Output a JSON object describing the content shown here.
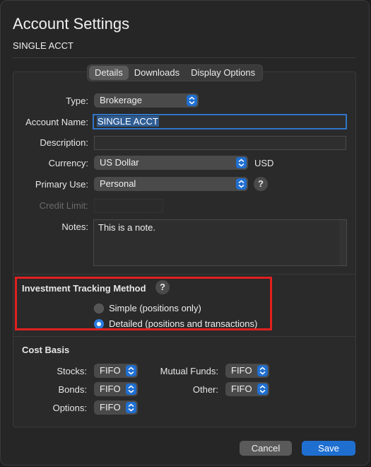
{
  "window": {
    "title": "Account Settings",
    "subtitle": "SINGLE ACCT"
  },
  "tabs": [
    {
      "label": "Details",
      "active": true
    },
    {
      "label": "Downloads",
      "active": false
    },
    {
      "label": "Display Options",
      "active": false
    }
  ],
  "details": {
    "type_label": "Type:",
    "type_value": "Brokerage",
    "account_name_label": "Account Name:",
    "account_name_value": "SINGLE ACCT",
    "description_label": "Description:",
    "description_value": "",
    "currency_label": "Currency:",
    "currency_value": "US Dollar",
    "currency_code": "USD",
    "primary_use_label": "Primary Use:",
    "primary_use_value": "Personal",
    "credit_limit_label": "Credit Limit:",
    "credit_limit_value": "",
    "notes_label": "Notes:",
    "notes_value": "This is a note."
  },
  "tracking": {
    "title": "Investment Tracking Method",
    "help": "?",
    "options": [
      {
        "label": "Simple (positions only)",
        "selected": false
      },
      {
        "label": "Detailed (positions and transactions)",
        "selected": true
      }
    ]
  },
  "cost_basis": {
    "title": "Cost Basis",
    "stocks_label": "Stocks:",
    "stocks_value": "FIFO",
    "bonds_label": "Bonds:",
    "bonds_value": "FIFO",
    "options_label": "Options:",
    "options_value": "FIFO",
    "mutual_funds_label": "Mutual Funds:",
    "mutual_funds_value": "FIFO",
    "other_label": "Other:",
    "other_value": "FIFO"
  },
  "buttons": {
    "cancel": "Cancel",
    "save": "Save"
  },
  "help_glyph": "?",
  "colors": {
    "accent": "#1f6fd1",
    "highlight": "#e0201f"
  }
}
